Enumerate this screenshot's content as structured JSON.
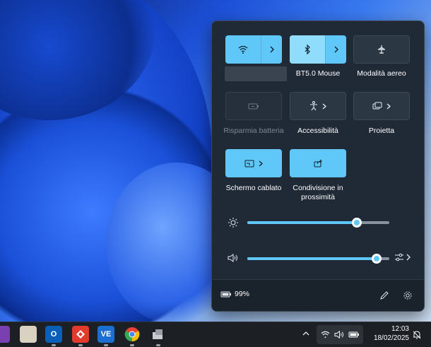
{
  "quick_settings": {
    "tiles": [
      {
        "id": "wifi",
        "label": "",
        "state": "on",
        "icon": "wifi-icon"
      },
      {
        "id": "bluetooth",
        "label": "BT5.0 Mouse",
        "state": "on",
        "icon": "bluetooth-icon"
      },
      {
        "id": "airplane",
        "label": "Modalità aereo",
        "state": "off",
        "icon": "airplane-icon"
      },
      {
        "id": "battery_saver",
        "label": "Risparmia batteria",
        "state": "disabled",
        "icon": "battery-saver-icon"
      },
      {
        "id": "accessibility",
        "label": "Accessibilità",
        "state": "off",
        "icon": "accessibility-icon"
      },
      {
        "id": "project",
        "label": "Proietta",
        "state": "off",
        "icon": "project-icon"
      },
      {
        "id": "cast",
        "label": "Schermo cablato",
        "state": "on",
        "icon": "cast-icon"
      },
      {
        "id": "nearby_share",
        "label": "Condivisione in prossimità",
        "state": "on",
        "icon": "share-icon"
      }
    ],
    "brightness": {
      "value": 0.77
    },
    "volume": {
      "value": 0.91
    },
    "battery": {
      "percent_text": "99%"
    }
  },
  "taskbar": {
    "apps": [
      {
        "name": "app-1",
        "icon": "app-icon"
      },
      {
        "name": "app-2",
        "icon": "app-icon"
      },
      {
        "name": "outlook",
        "icon": "outlook-icon",
        "text": "O"
      },
      {
        "name": "anydesk",
        "icon": "anydesk-icon"
      },
      {
        "name": "vs",
        "icon": "vs-icon",
        "text": "VE"
      },
      {
        "name": "chrome",
        "icon": "chrome-icon"
      },
      {
        "name": "app-7",
        "icon": "app-icon"
      }
    ],
    "clock": {
      "time": "12:03",
      "date": "18/02/2025"
    }
  },
  "colors": {
    "accent": "#60c8f8",
    "panel": "#202a36",
    "taskbar": "#1c1f24"
  }
}
